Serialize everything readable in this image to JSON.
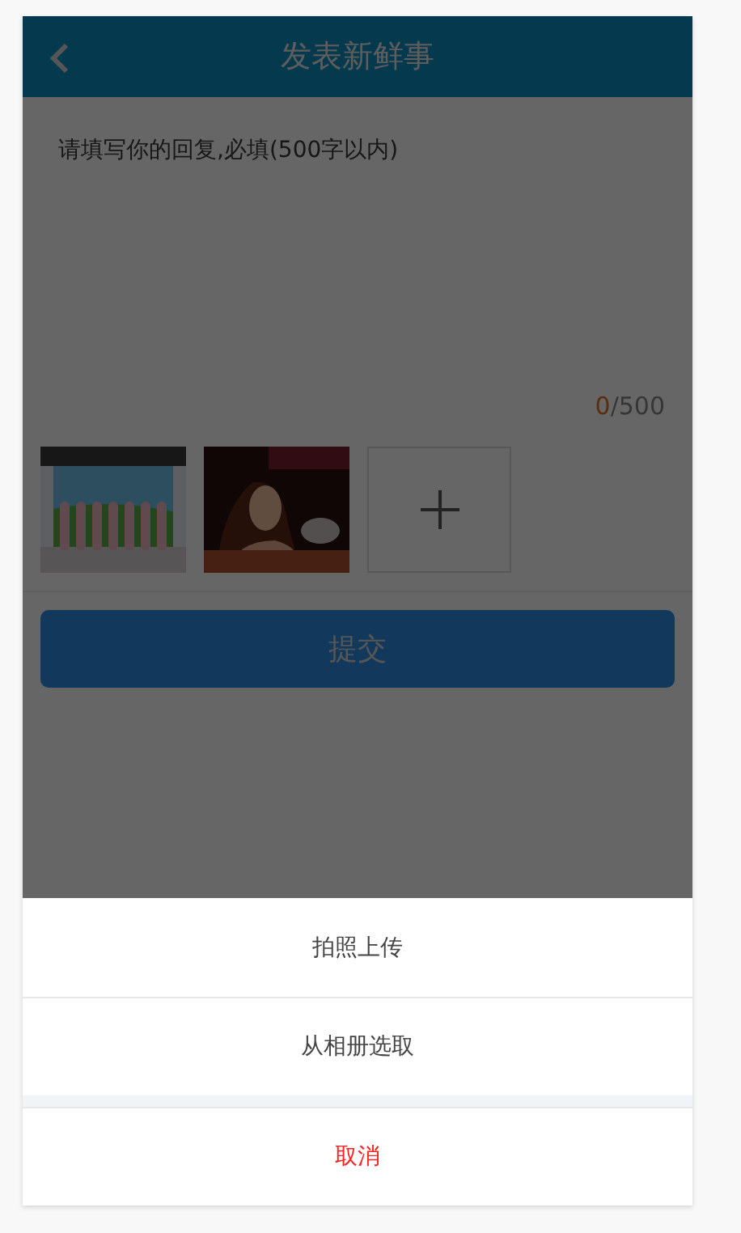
{
  "header": {
    "title": "发表新鲜事"
  },
  "reply": {
    "placeholder": "请填写你的回复,必填(500字以内)",
    "count": "0",
    "limit": "/500"
  },
  "photos": [
    {
      "kind": "stage"
    },
    {
      "kind": "portrait"
    }
  ],
  "submit": "提交",
  "action_sheet": {
    "items": [
      "拍照上传",
      "从相册选取"
    ],
    "cancel": "取消"
  }
}
